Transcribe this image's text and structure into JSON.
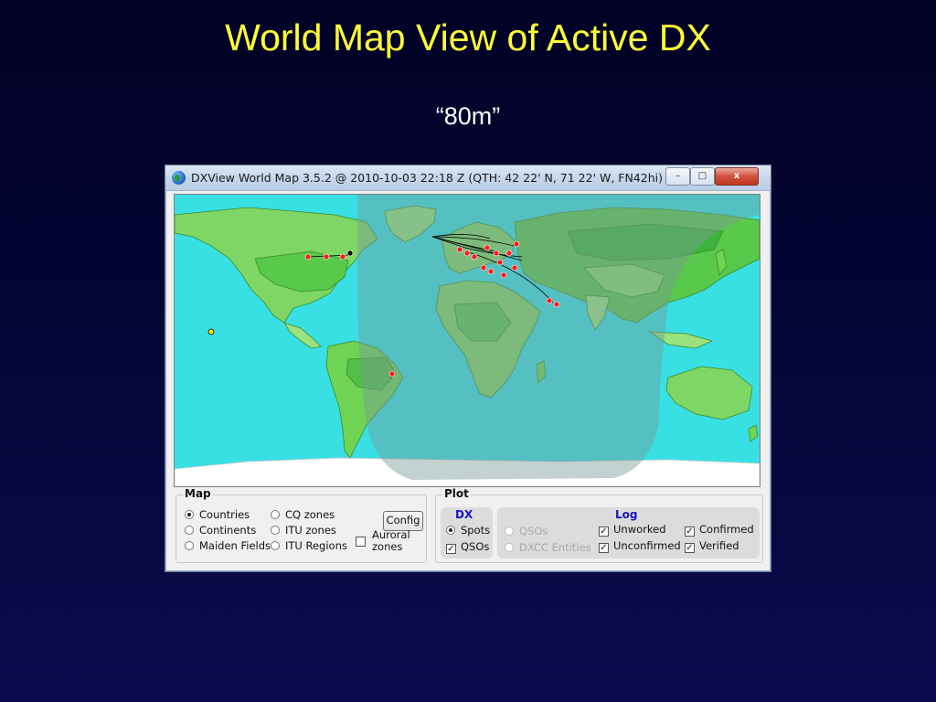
{
  "slide": {
    "title": "World Map View of Active DX",
    "subtitle": "“80m”"
  },
  "window": {
    "title": "DXView World Map 3.5.2 @ 2010-10-03  22:18 Z  (QTH:  42  22' N,  71  22' W, FN42hi)",
    "buttons": {
      "minimize": "–",
      "maximize": "□",
      "close": "x"
    }
  },
  "map_panel": {
    "legend": "Map",
    "radios": [
      {
        "label": "Countries",
        "selected": true
      },
      {
        "label": "Continents",
        "selected": false
      },
      {
        "label": "Maiden Fields",
        "selected": false
      },
      {
        "label": "CQ zones",
        "selected": false
      },
      {
        "label": "ITU zones",
        "selected": false
      },
      {
        "label": "ITU Regions",
        "selected": false
      }
    ],
    "config_label": "Config",
    "auroral_label_line1": "Auroral",
    "auroral_label_line2": "zones",
    "auroral_checked": false
  },
  "plot_panel": {
    "legend": "Plot",
    "dx": {
      "heading": "DX",
      "spots_label": "Spots",
      "spots_selected": true,
      "qsos_label": "QSOs",
      "qsos_checked": true
    },
    "disabled_radios": [
      {
        "label": "QSOs"
      },
      {
        "label": "DXCC Entities"
      }
    ],
    "log": {
      "heading": "Log",
      "checks": [
        {
          "label": "Unworked",
          "checked": true
        },
        {
          "label": "Confirmed",
          "checked": true
        },
        {
          "label": "Unconfirmed",
          "checked": true
        },
        {
          "label": "Verified",
          "checked": true
        }
      ]
    }
  },
  "colors": {
    "ocean": "#38e0e4",
    "land": "#6fd453",
    "night_shade": "#7a9a98",
    "spot": "#ff1a1a",
    "title": "#ffff33"
  }
}
